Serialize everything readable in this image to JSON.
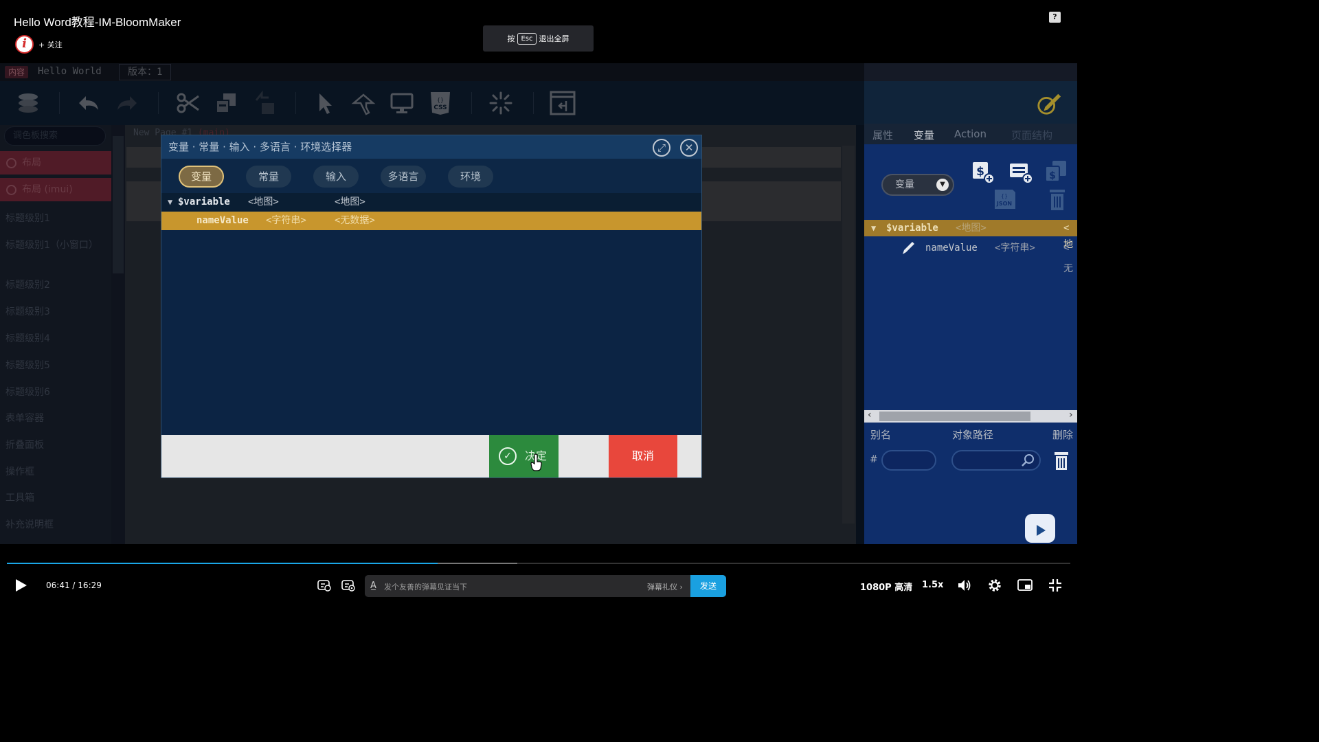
{
  "video": {
    "title": "Hello Word教程-IM-BloomMaker",
    "follow_label": "+ 关注",
    "logo_text": "i",
    "esc_hint_prefix": "按",
    "esc_key": "Esc",
    "esc_hint_suffix": "退出全屏",
    "help_icon": "?"
  },
  "app": {
    "tab_badge": "内容",
    "tab_name": "Hello World",
    "version_chip": "版本：1",
    "toolbar_icons": [
      "layers-icon",
      "undo-icon",
      "redo-icon",
      "cut-icon",
      "copy-icon",
      "paste-icon",
      "pointer-icon",
      "hand-pointer-icon",
      "monitor-icon",
      "css-icon",
      "loading-icon",
      "frame-icon",
      "pen-icon"
    ],
    "sidebar": {
      "search_placeholder": "调色板搜索",
      "categories": [
        "布局",
        "布局 (imui)"
      ],
      "items": [
        "标题级别1",
        "标题级别1（小窗口）",
        "标题级别2",
        "标题级别3",
        "标题级别4",
        "标题级别5",
        "标题级别6",
        "表单容器",
        "折叠面板",
        "操作框",
        "工具箱",
        "补充说明框"
      ]
    },
    "canvas": {
      "page_tab": "New Page #1",
      "page_tab_suffix": "(main)"
    },
    "right_panel": {
      "tabs": [
        "属性",
        "变量",
        "Action",
        "页面结构"
      ],
      "active_tab": "变量",
      "select_value": "变量",
      "tree_root": "$variable",
      "tree_root_type": "<地图>",
      "tree_root_value": "<地",
      "tree_child": "nameValue",
      "tree_child_type": "<字符串>",
      "tree_child_value": "<无",
      "columns": [
        "别名",
        "对象路径",
        "删除"
      ],
      "hash": "#"
    }
  },
  "dialog": {
    "title": "变量 · 常量 · 输入 · 多语言 · 环境选择器",
    "tabs": [
      "变量",
      "常量",
      "输入",
      "多语言",
      "环境"
    ],
    "active_tab": "变量",
    "rows": [
      {
        "name": "$variable",
        "type": "<地图>",
        "value": "<地图>"
      },
      {
        "name": "nameValue",
        "type": "<字符串>",
        "value": "<无数据>"
      }
    ],
    "ok_label": "决定",
    "cancel_label": "取消"
  },
  "player": {
    "time_current": "06:41",
    "time_sep": "/",
    "time_total": "16:29",
    "progress": 0.405,
    "buffered": 0.48,
    "danmaku_placeholder": "发个友善的弹幕见证当下",
    "danmaku_etiquette": "弹幕礼仪 ›",
    "send_label": "发送",
    "quality": "1080P 高清",
    "speed": "1.5x"
  },
  "colors": {
    "accent_blue": "#1aa7e8",
    "ok_green": "#2c8a3d",
    "cancel_red": "#e8473c",
    "selection_gold": "#c8962d"
  }
}
